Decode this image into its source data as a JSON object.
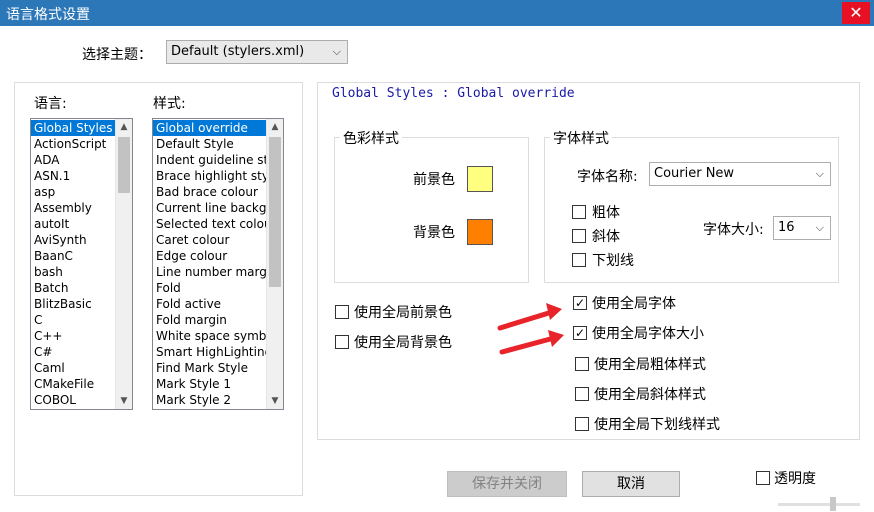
{
  "window": {
    "title": "语言格式设置",
    "close_glyph": "✕"
  },
  "theme": {
    "label": "选择主题：",
    "selected": "Default (stylers.xml)"
  },
  "language": {
    "label": "语言:",
    "items": [
      "Global Styles",
      "ActionScript",
      "ADA",
      "ASN.1",
      "asp",
      "Assembly",
      "autoIt",
      "AviSynth",
      "BaanC",
      "bash",
      "Batch",
      "BlitzBasic",
      "C",
      "C++",
      "C#",
      "Caml",
      "CMakeFile",
      "COBOL"
    ],
    "selected_index": 0
  },
  "style": {
    "label": "样式:",
    "items": [
      "Global override",
      "Default Style",
      "Indent guideline st",
      "Brace highlight styl",
      "Bad brace colour",
      "Current line backgr",
      "Selected text colou",
      "Caret colour",
      "Edge colour",
      "Line number marg",
      "Fold",
      "Fold active",
      "Fold margin",
      "White space symbo",
      "Smart HighLighting",
      "Find Mark Style",
      "Mark Style 1",
      "Mark Style 2"
    ],
    "selected_index": 0
  },
  "header": {
    "text": "Global Styles : Global override"
  },
  "color_group": {
    "title": "色彩样式",
    "fg_label": "前景色",
    "fg_color": "#ffff80",
    "bg_label": "背景色",
    "bg_color": "#ff8000"
  },
  "font_group": {
    "title": "字体样式",
    "name_label": "字体名称:",
    "name_value": "Courier New",
    "bold": "粗体",
    "italic": "斜体",
    "underline": "下划线",
    "size_label": "字体大小:",
    "size_value": "16"
  },
  "global_checks": {
    "use_global_fg": "使用全局前景色",
    "use_global_bg": "使用全局背景色",
    "use_global_font": "使用全局字体",
    "use_global_font_size": "使用全局字体大小",
    "use_global_bold": "使用全局粗体样式",
    "use_global_italic": "使用全局斜体样式",
    "use_global_underline": "使用全局下划线样式"
  },
  "buttons": {
    "save_close": "保存并关闭",
    "cancel": "取消"
  },
  "transparency": {
    "label": "透明度"
  },
  "annotations": {
    "arrow_color": "#e8232a"
  }
}
